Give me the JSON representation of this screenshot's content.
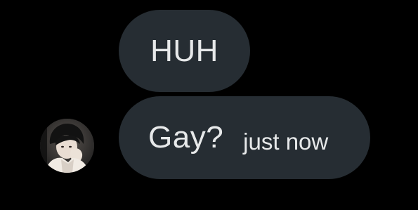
{
  "conversation": {
    "messages": [
      {
        "text": "HUH"
      },
      {
        "text": "Gay?",
        "timestamp": "just now"
      }
    ],
    "sender": {
      "avatar_icon": "user-avatar-photo"
    }
  },
  "colors": {
    "background": "#000000",
    "bubble": "#262d33",
    "text": "#e7e9ea"
  }
}
